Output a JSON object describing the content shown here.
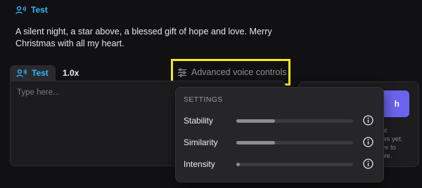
{
  "voice": {
    "name": "Test",
    "icon": "voice-wave-icon",
    "color": "#2fb7ff"
  },
  "intro_text": "A silent night, a star above, a blessed gift of hope and love. Merry Christmas with all my heart.",
  "tabs": {
    "voice_label": "Test",
    "speed": "1.0x"
  },
  "advanced": {
    "label": "Advanced voice controls",
    "icon": "sliders-icon",
    "highlight_color": "#f3ea1a"
  },
  "input": {
    "placeholder": "Type here..."
  },
  "right_card": {
    "button_label_visible": "h",
    "button_color": "#6b63ef",
    "note_visible": "not\nples yet.\nove to\nnple."
  },
  "settings": {
    "heading": "SETTINGS",
    "items": [
      {
        "label": "Stability",
        "value": 0.33
      },
      {
        "label": "Similarity",
        "value": 0.33
      },
      {
        "label": "Intensity",
        "value": 0.03
      }
    ]
  }
}
